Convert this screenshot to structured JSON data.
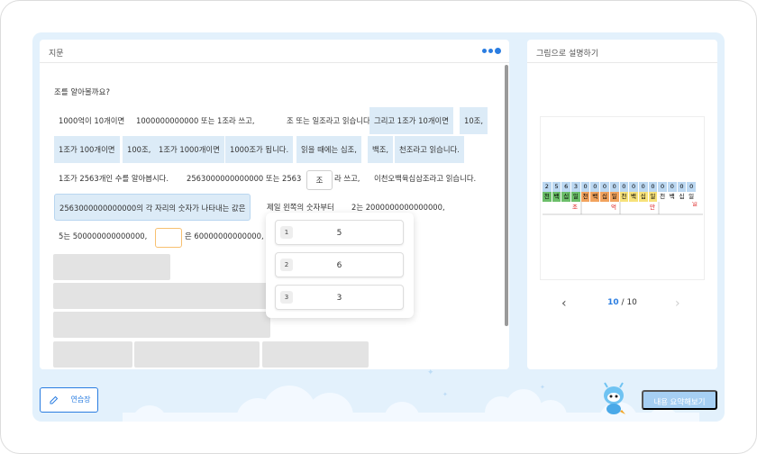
{
  "left_panel": {
    "title": "지문",
    "question": "조를 알아볼까요?",
    "line1": [
      "1000억이 10개이면",
      "1000000000000 또는 1조라 쓰고,",
      "조 또는 일조라고 읽습니다.",
      "그리고 1조가 10개이면",
      "10조,"
    ],
    "line2": [
      "1조가 100개이면",
      "100조,",
      "1조가 1000개이면",
      "1000조가 됩니다.",
      "읽을 때에는 십조,",
      "백조,",
      "천조라고 읽습니다."
    ],
    "line3": [
      "1조가 2563개인 수를 알아봅시다.",
      "2563000000000000 또는 2563",
      "조",
      "라 쓰고,",
      "이천오백육십삼조라고 읽습니다."
    ],
    "line4": [
      "2563000000000000의 각 자리의 숫자가 나타내는 값은",
      "제일 왼쪽의 숫자부터",
      "2는 2000000000000000,"
    ],
    "line5": [
      "5는 500000000000000,",
      "은 60000000000000,"
    ]
  },
  "popup": {
    "options": [
      {
        "num": "1",
        "value": "5"
      },
      {
        "num": "2",
        "value": "6"
      },
      {
        "num": "3",
        "value": "3"
      }
    ]
  },
  "right_panel": {
    "title": "그림으로 설명하기",
    "digits": [
      "2",
      "5",
      "6",
      "3",
      "0",
      "0",
      "0",
      "0",
      "0",
      "0",
      "0",
      "0",
      "0",
      "0",
      "0",
      "0"
    ],
    "places": [
      "천",
      "백",
      "십",
      "일",
      "천",
      "백",
      "십",
      "일",
      "천",
      "백",
      "십",
      "일",
      "천",
      "백",
      "십",
      "일"
    ],
    "units": {
      "jo": "조",
      "eok": "억",
      "man": "만",
      "il": "일"
    },
    "pager": {
      "current": "10",
      "sep": "/",
      "total": "10"
    },
    "prev_icon": "‹",
    "next_icon": "›"
  },
  "buttons": {
    "memo": "연습장",
    "summary": "내용 요약해보기"
  },
  "colors": {
    "accent": "#2a7de1",
    "stage": "#e3f1fc",
    "highlight": "#dcebf7"
  }
}
